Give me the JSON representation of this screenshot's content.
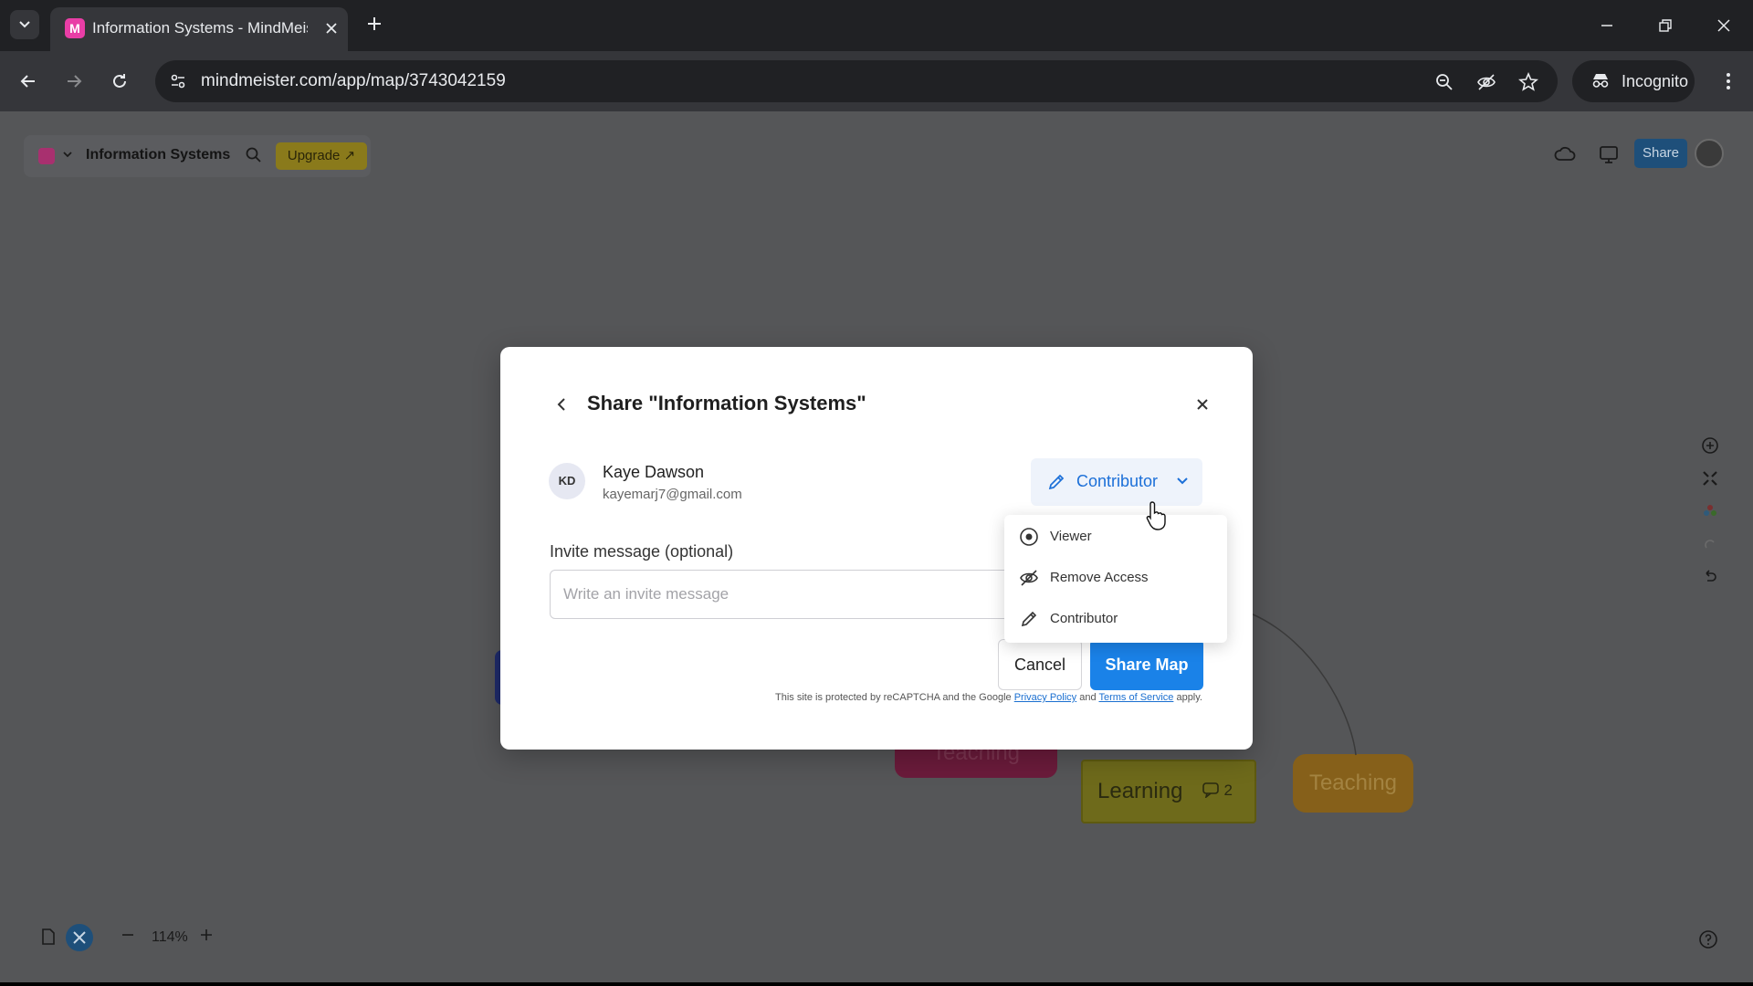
{
  "browser": {
    "tab_title": "Information Systems - MindMeister",
    "url": "mindmeister.com/app/map/3743042159",
    "incognito_label": "Incognito"
  },
  "app": {
    "map_title": "Information Systems",
    "upgrade_label": "Upgrade ↗",
    "share_label": "Share",
    "zoom_level": "114%"
  },
  "map_nodes": {
    "learning": "Learning",
    "learning_count": "2",
    "teaching_right": "Teaching",
    "teaching_left": "Teaching"
  },
  "modal": {
    "title": "Share \"Information Systems\"",
    "user": {
      "initials": "KD",
      "name": "Kaye Dawson",
      "email": "kayemarj7@gmail.com"
    },
    "role_selected": "Contributor",
    "invite_label": "Invite message (optional)",
    "invite_placeholder": "Write an invite message",
    "cancel_label": "Cancel",
    "share_map_label": "Share Map",
    "recaptcha": {
      "prefix": "This site is protected by reCAPTCHA and the Google",
      "privacy": "Privacy Policy",
      "and": "and",
      "terms": "Terms of Service",
      "suffix": "apply."
    },
    "role_options": [
      {
        "label": "Viewer",
        "icon": "eye-icon"
      },
      {
        "label": "Remove Access",
        "icon": "eye-off-icon"
      },
      {
        "label": "Contributor",
        "icon": "pencil-icon"
      }
    ]
  },
  "colors": {
    "accent": "#1a82e8",
    "role_text": "#1b6fd8"
  }
}
